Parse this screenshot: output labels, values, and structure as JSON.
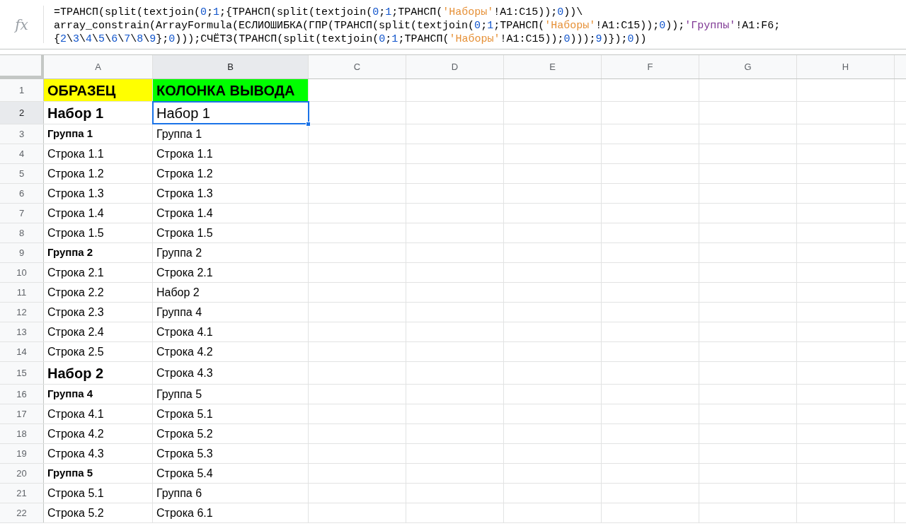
{
  "formula_bar": {
    "icon_text": "fx",
    "lines": [
      [
        {
          "text": "=ТРАНСП(split(textjoin(",
          "kind": "plain"
        },
        {
          "text": "0",
          "kind": "number"
        },
        {
          "text": ";",
          "kind": "plain"
        },
        {
          "text": "1",
          "kind": "number"
        },
        {
          "text": ";{ТРАНСП(split(textjoin(",
          "kind": "plain"
        },
        {
          "text": "0",
          "kind": "number"
        },
        {
          "text": ";",
          "kind": "plain"
        },
        {
          "text": "1",
          "kind": "number"
        },
        {
          "text": ";ТРАНСП(",
          "kind": "plain"
        },
        {
          "text": "'Наборы'",
          "kind": "sheet"
        },
        {
          "text": "!A1:C15));",
          "kind": "plain"
        },
        {
          "text": "0",
          "kind": "number"
        },
        {
          "text": "))\\",
          "kind": "plain"
        }
      ],
      [
        {
          "text": "array_constrain(ArrayFormula(ЕСЛИОШИБКА(ГПР(ТРАНСП(split(textjoin(",
          "kind": "plain"
        },
        {
          "text": "0",
          "kind": "number"
        },
        {
          "text": ";",
          "kind": "plain"
        },
        {
          "text": "1",
          "kind": "number"
        },
        {
          "text": ";ТРАНСП(",
          "kind": "plain"
        },
        {
          "text": "'Наборы'",
          "kind": "sheet"
        },
        {
          "text": "!A1:C15));",
          "kind": "plain"
        },
        {
          "text": "0",
          "kind": "number"
        },
        {
          "text": "));",
          "kind": "plain"
        },
        {
          "text": "'Группы'",
          "kind": "othersheet"
        },
        {
          "text": "!A1:F6;",
          "kind": "plain"
        }
      ],
      [
        {
          "text": "{",
          "kind": "plain"
        },
        {
          "text": "2",
          "kind": "number"
        },
        {
          "text": "\\",
          "kind": "plain"
        },
        {
          "text": "3",
          "kind": "number"
        },
        {
          "text": "\\",
          "kind": "plain"
        },
        {
          "text": "4",
          "kind": "number"
        },
        {
          "text": "\\",
          "kind": "plain"
        },
        {
          "text": "5",
          "kind": "number"
        },
        {
          "text": "\\",
          "kind": "plain"
        },
        {
          "text": "6",
          "kind": "number"
        },
        {
          "text": "\\",
          "kind": "plain"
        },
        {
          "text": "7",
          "kind": "number"
        },
        {
          "text": "\\",
          "kind": "plain"
        },
        {
          "text": "8",
          "kind": "number"
        },
        {
          "text": "\\",
          "kind": "plain"
        },
        {
          "text": "9",
          "kind": "number"
        },
        {
          "text": "};",
          "kind": "plain"
        },
        {
          "text": "0",
          "kind": "number"
        },
        {
          "text": ")));СЧЁТЗ(ТРАНСП(split(textjoin(",
          "kind": "plain"
        },
        {
          "text": "0",
          "kind": "number"
        },
        {
          "text": ";",
          "kind": "plain"
        },
        {
          "text": "1",
          "kind": "number"
        },
        {
          "text": ";ТРАНСП(",
          "kind": "plain"
        },
        {
          "text": "'Наборы'",
          "kind": "sheet"
        },
        {
          "text": "!A1:C15));",
          "kind": "plain"
        },
        {
          "text": "0",
          "kind": "number"
        },
        {
          "text": ")));",
          "kind": "plain"
        },
        {
          "text": "9",
          "kind": "number"
        },
        {
          "text": ")});",
          "kind": "plain"
        },
        {
          "text": "0",
          "kind": "number"
        },
        {
          "text": "))",
          "kind": "plain"
        }
      ]
    ]
  },
  "columns": [
    {
      "label": "A",
      "selected": false
    },
    {
      "label": "B",
      "selected": true
    },
    {
      "label": "C",
      "selected": false
    },
    {
      "label": "D",
      "selected": false
    },
    {
      "label": "E",
      "selected": false
    },
    {
      "label": "F",
      "selected": false
    },
    {
      "label": "G",
      "selected": false
    },
    {
      "label": "H",
      "selected": false
    }
  ],
  "rows": [
    {
      "label": "1",
      "selected": false,
      "cells": [
        {
          "text": "ОБРАЗЕЦ",
          "kind": "header",
          "color": "#ffff00",
          "selected": false
        },
        {
          "text": "КОЛОНКА ВЫВОДА",
          "kind": "header",
          "color": "#00ff00",
          "selected": false
        }
      ]
    },
    {
      "label": "2",
      "selected": true,
      "cells": [
        {
          "text": "Набор 1",
          "kind": "set",
          "selected": false
        },
        {
          "text": "Набор 1",
          "kind": "big",
          "selected": true
        }
      ]
    },
    {
      "label": "3",
      "selected": false,
      "cells": [
        {
          "text": "Группа 1",
          "kind": "group",
          "selected": false
        },
        {
          "text": "Группа 1",
          "kind": "line",
          "selected": false
        }
      ]
    },
    {
      "label": "4",
      "selected": false,
      "cells": [
        {
          "text": "Строка 1.1",
          "kind": "line",
          "selected": false
        },
        {
          "text": "Строка 1.1",
          "kind": "line",
          "selected": false
        }
      ]
    },
    {
      "label": "5",
      "selected": false,
      "cells": [
        {
          "text": "Строка 1.2",
          "kind": "line",
          "selected": false
        },
        {
          "text": "Строка 1.2",
          "kind": "line",
          "selected": false
        }
      ]
    },
    {
      "label": "6",
      "selected": false,
      "cells": [
        {
          "text": "Строка 1.3",
          "kind": "line",
          "selected": false
        },
        {
          "text": "Строка 1.3",
          "kind": "line",
          "selected": false
        }
      ]
    },
    {
      "label": "7",
      "selected": false,
      "cells": [
        {
          "text": "Строка 1.4",
          "kind": "line",
          "selected": false
        },
        {
          "text": "Строка 1.4",
          "kind": "line",
          "selected": false
        }
      ]
    },
    {
      "label": "8",
      "selected": false,
      "cells": [
        {
          "text": "Строка 1.5",
          "kind": "line",
          "selected": false
        },
        {
          "text": "Строка 1.5",
          "kind": "line",
          "selected": false
        }
      ]
    },
    {
      "label": "9",
      "selected": false,
      "cells": [
        {
          "text": "Группа 2",
          "kind": "group",
          "selected": false
        },
        {
          "text": "Группа 2",
          "kind": "line",
          "selected": false
        }
      ]
    },
    {
      "label": "10",
      "selected": false,
      "cells": [
        {
          "text": "Строка 2.1",
          "kind": "line",
          "selected": false
        },
        {
          "text": "Строка 2.1",
          "kind": "line",
          "selected": false
        }
      ]
    },
    {
      "label": "11",
      "selected": false,
      "cells": [
        {
          "text": "Строка 2.2",
          "kind": "line",
          "selected": false
        },
        {
          "text": "Набор 2",
          "kind": "line",
          "selected": false
        }
      ]
    },
    {
      "label": "12",
      "selected": false,
      "cells": [
        {
          "text": "Строка 2.3",
          "kind": "line",
          "selected": false
        },
        {
          "text": "Группа 4",
          "kind": "line",
          "selected": false
        }
      ]
    },
    {
      "label": "13",
      "selected": false,
      "cells": [
        {
          "text": "Строка 2.4",
          "kind": "line",
          "selected": false
        },
        {
          "text": "Строка 4.1",
          "kind": "line",
          "selected": false
        }
      ]
    },
    {
      "label": "14",
      "selected": false,
      "cells": [
        {
          "text": "Строка 2.5",
          "kind": "line",
          "selected": false
        },
        {
          "text": "Строка 4.2",
          "kind": "line",
          "selected": false
        }
      ]
    },
    {
      "label": "15",
      "selected": false,
      "cells": [
        {
          "text": "Набор 2",
          "kind": "set",
          "selected": false
        },
        {
          "text": "Строка 4.3",
          "kind": "line",
          "selected": false
        }
      ]
    },
    {
      "label": "16",
      "selected": false,
      "cells": [
        {
          "text": "Группа 4",
          "kind": "group",
          "selected": false
        },
        {
          "text": "Группа 5",
          "kind": "line",
          "selected": false
        }
      ]
    },
    {
      "label": "17",
      "selected": false,
      "cells": [
        {
          "text": "Строка 4.1",
          "kind": "line",
          "selected": false
        },
        {
          "text": "Строка 5.1",
          "kind": "line",
          "selected": false
        }
      ]
    },
    {
      "label": "18",
      "selected": false,
      "cells": [
        {
          "text": "Строка 4.2",
          "kind": "line",
          "selected": false
        },
        {
          "text": "Строка 5.2",
          "kind": "line",
          "selected": false
        }
      ]
    },
    {
      "label": "19",
      "selected": false,
      "cells": [
        {
          "text": "Строка 4.3",
          "kind": "line",
          "selected": false
        },
        {
          "text": "Строка 5.3",
          "kind": "line",
          "selected": false
        }
      ]
    },
    {
      "label": "20",
      "selected": false,
      "cells": [
        {
          "text": "Группа 5",
          "kind": "group",
          "selected": false
        },
        {
          "text": "Строка 5.4",
          "kind": "line",
          "selected": false
        }
      ]
    },
    {
      "label": "21",
      "selected": false,
      "cells": [
        {
          "text": "Строка 5.1",
          "kind": "line",
          "selected": false
        },
        {
          "text": "Группа 6",
          "kind": "line",
          "selected": false
        }
      ]
    },
    {
      "label": "22",
      "selected": false,
      "cells": [
        {
          "text": "Строка 5.2",
          "kind": "line",
          "selected": false
        },
        {
          "text": "Строка 6.1",
          "kind": "line",
          "selected": false
        }
      ]
    }
  ]
}
